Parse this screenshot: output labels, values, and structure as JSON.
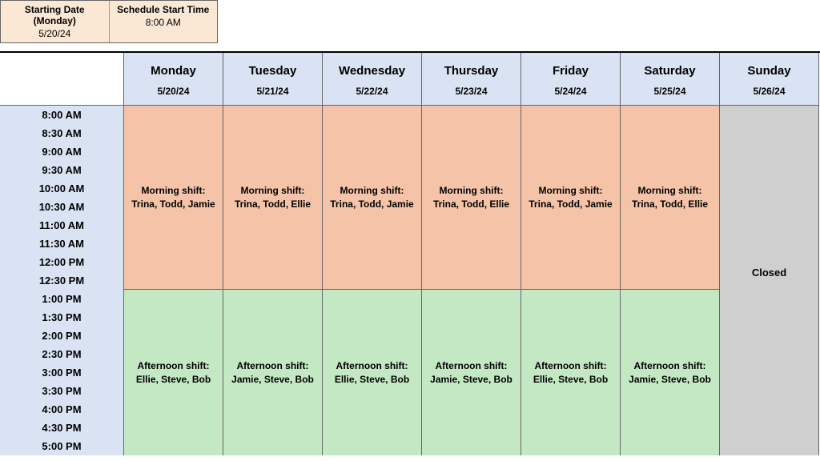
{
  "meta": {
    "starting_label": "Starting Date (Monday)",
    "starting_value": "5/20/24",
    "start_time_label": "Schedule Start Time",
    "start_time_value": "8:00 AM"
  },
  "days": [
    {
      "name": "Monday",
      "date": "5/20/24"
    },
    {
      "name": "Tuesday",
      "date": "5/21/24"
    },
    {
      "name": "Wednesday",
      "date": "5/22/24"
    },
    {
      "name": "Thursday",
      "date": "5/23/24"
    },
    {
      "name": "Friday",
      "date": "5/24/24"
    },
    {
      "name": "Saturday",
      "date": "5/25/24"
    },
    {
      "name": "Sunday",
      "date": "5/26/24"
    }
  ],
  "times": [
    "8:00 AM",
    "8:30 AM",
    "9:00 AM",
    "9:30 AM",
    "10:00 AM",
    "10:30 AM",
    "11:00 AM",
    "11:30 AM",
    "12:00 PM",
    "12:30 PM",
    "1:00 PM",
    "1:30 PM",
    "2:00 PM",
    "2:30 PM",
    "3:00 PM",
    "3:30 PM",
    "4:00 PM",
    "4:30 PM",
    "5:00 PM"
  ],
  "shifts": {
    "monday": {
      "morning": "Morning shift: Trina, Todd, Jamie",
      "afternoon": "Afternoon shift: Ellie, Steve, Bob"
    },
    "tuesday": {
      "morning": "Morning shift: Trina, Todd, Ellie",
      "afternoon": "Afternoon shift: Jamie, Steve, Bob"
    },
    "wednesday": {
      "morning": "Morning shift: Trina, Todd, Jamie",
      "afternoon": "Afternoon shift: Ellie, Steve, Bob"
    },
    "thursday": {
      "morning": "Morning shift: Trina, Todd, Ellie",
      "afternoon": "Afternoon shift: Jamie, Steve, Bob"
    },
    "friday": {
      "morning": "Morning shift: Trina, Todd, Jamie",
      "afternoon": "Afternoon shift: Ellie, Steve, Bob"
    },
    "saturday": {
      "morning": "Morning shift: Trina, Todd, Ellie",
      "afternoon": "Afternoon shift: Jamie, Steve, Bob"
    },
    "sunday": {
      "closed": "Closed"
    }
  }
}
